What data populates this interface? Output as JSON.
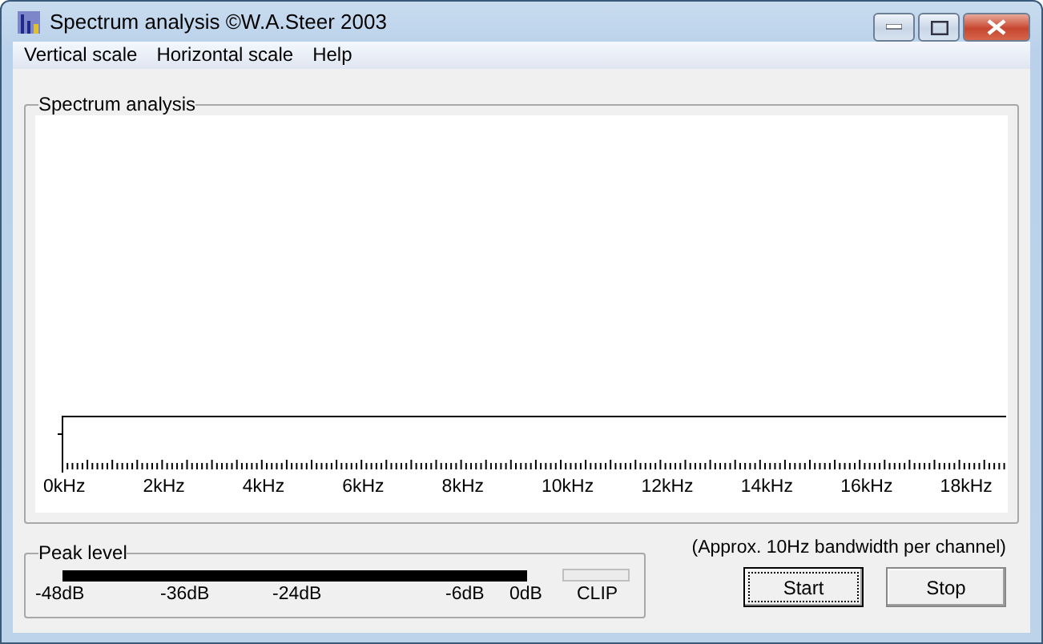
{
  "window": {
    "title": "Spectrum analysis  ©W.A.Steer 2003"
  },
  "menu": [
    "Vertical scale",
    "Horizontal scale",
    "Help"
  ],
  "spectrum": {
    "title": "Spectrum analysis",
    "axis_labels": [
      "0kHz",
      "2kHz",
      "4kHz",
      "6kHz",
      "8kHz",
      "10kHz",
      "12kHz",
      "14kHz",
      "16kHz",
      "18kHz"
    ]
  },
  "peak": {
    "title": "Peak level",
    "level": 1,
    "scale": [
      "-48dB",
      "-36dB",
      "-24dB",
      "-6dB",
      "0dB"
    ],
    "clip": {
      "label": "CLIP",
      "on": false
    }
  },
  "note": "(Approx. 10Hz bandwidth per channel)",
  "buttons": [
    {
      "label": "Start",
      "focused": true
    },
    {
      "label": "Stop",
      "focused": false
    }
  ]
}
